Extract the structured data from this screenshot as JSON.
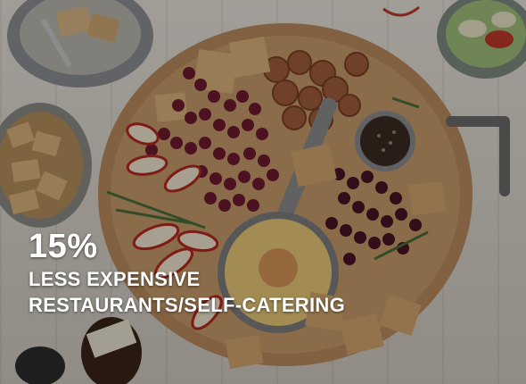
{
  "image": {
    "subject": "photo-of-charcuterie-board",
    "overlay_color": "#000000"
  },
  "caption": {
    "percentage": "15%",
    "line1": "LESS EXPENSIVE",
    "line2": "RESTAURANTS/SELF-CATERING"
  }
}
